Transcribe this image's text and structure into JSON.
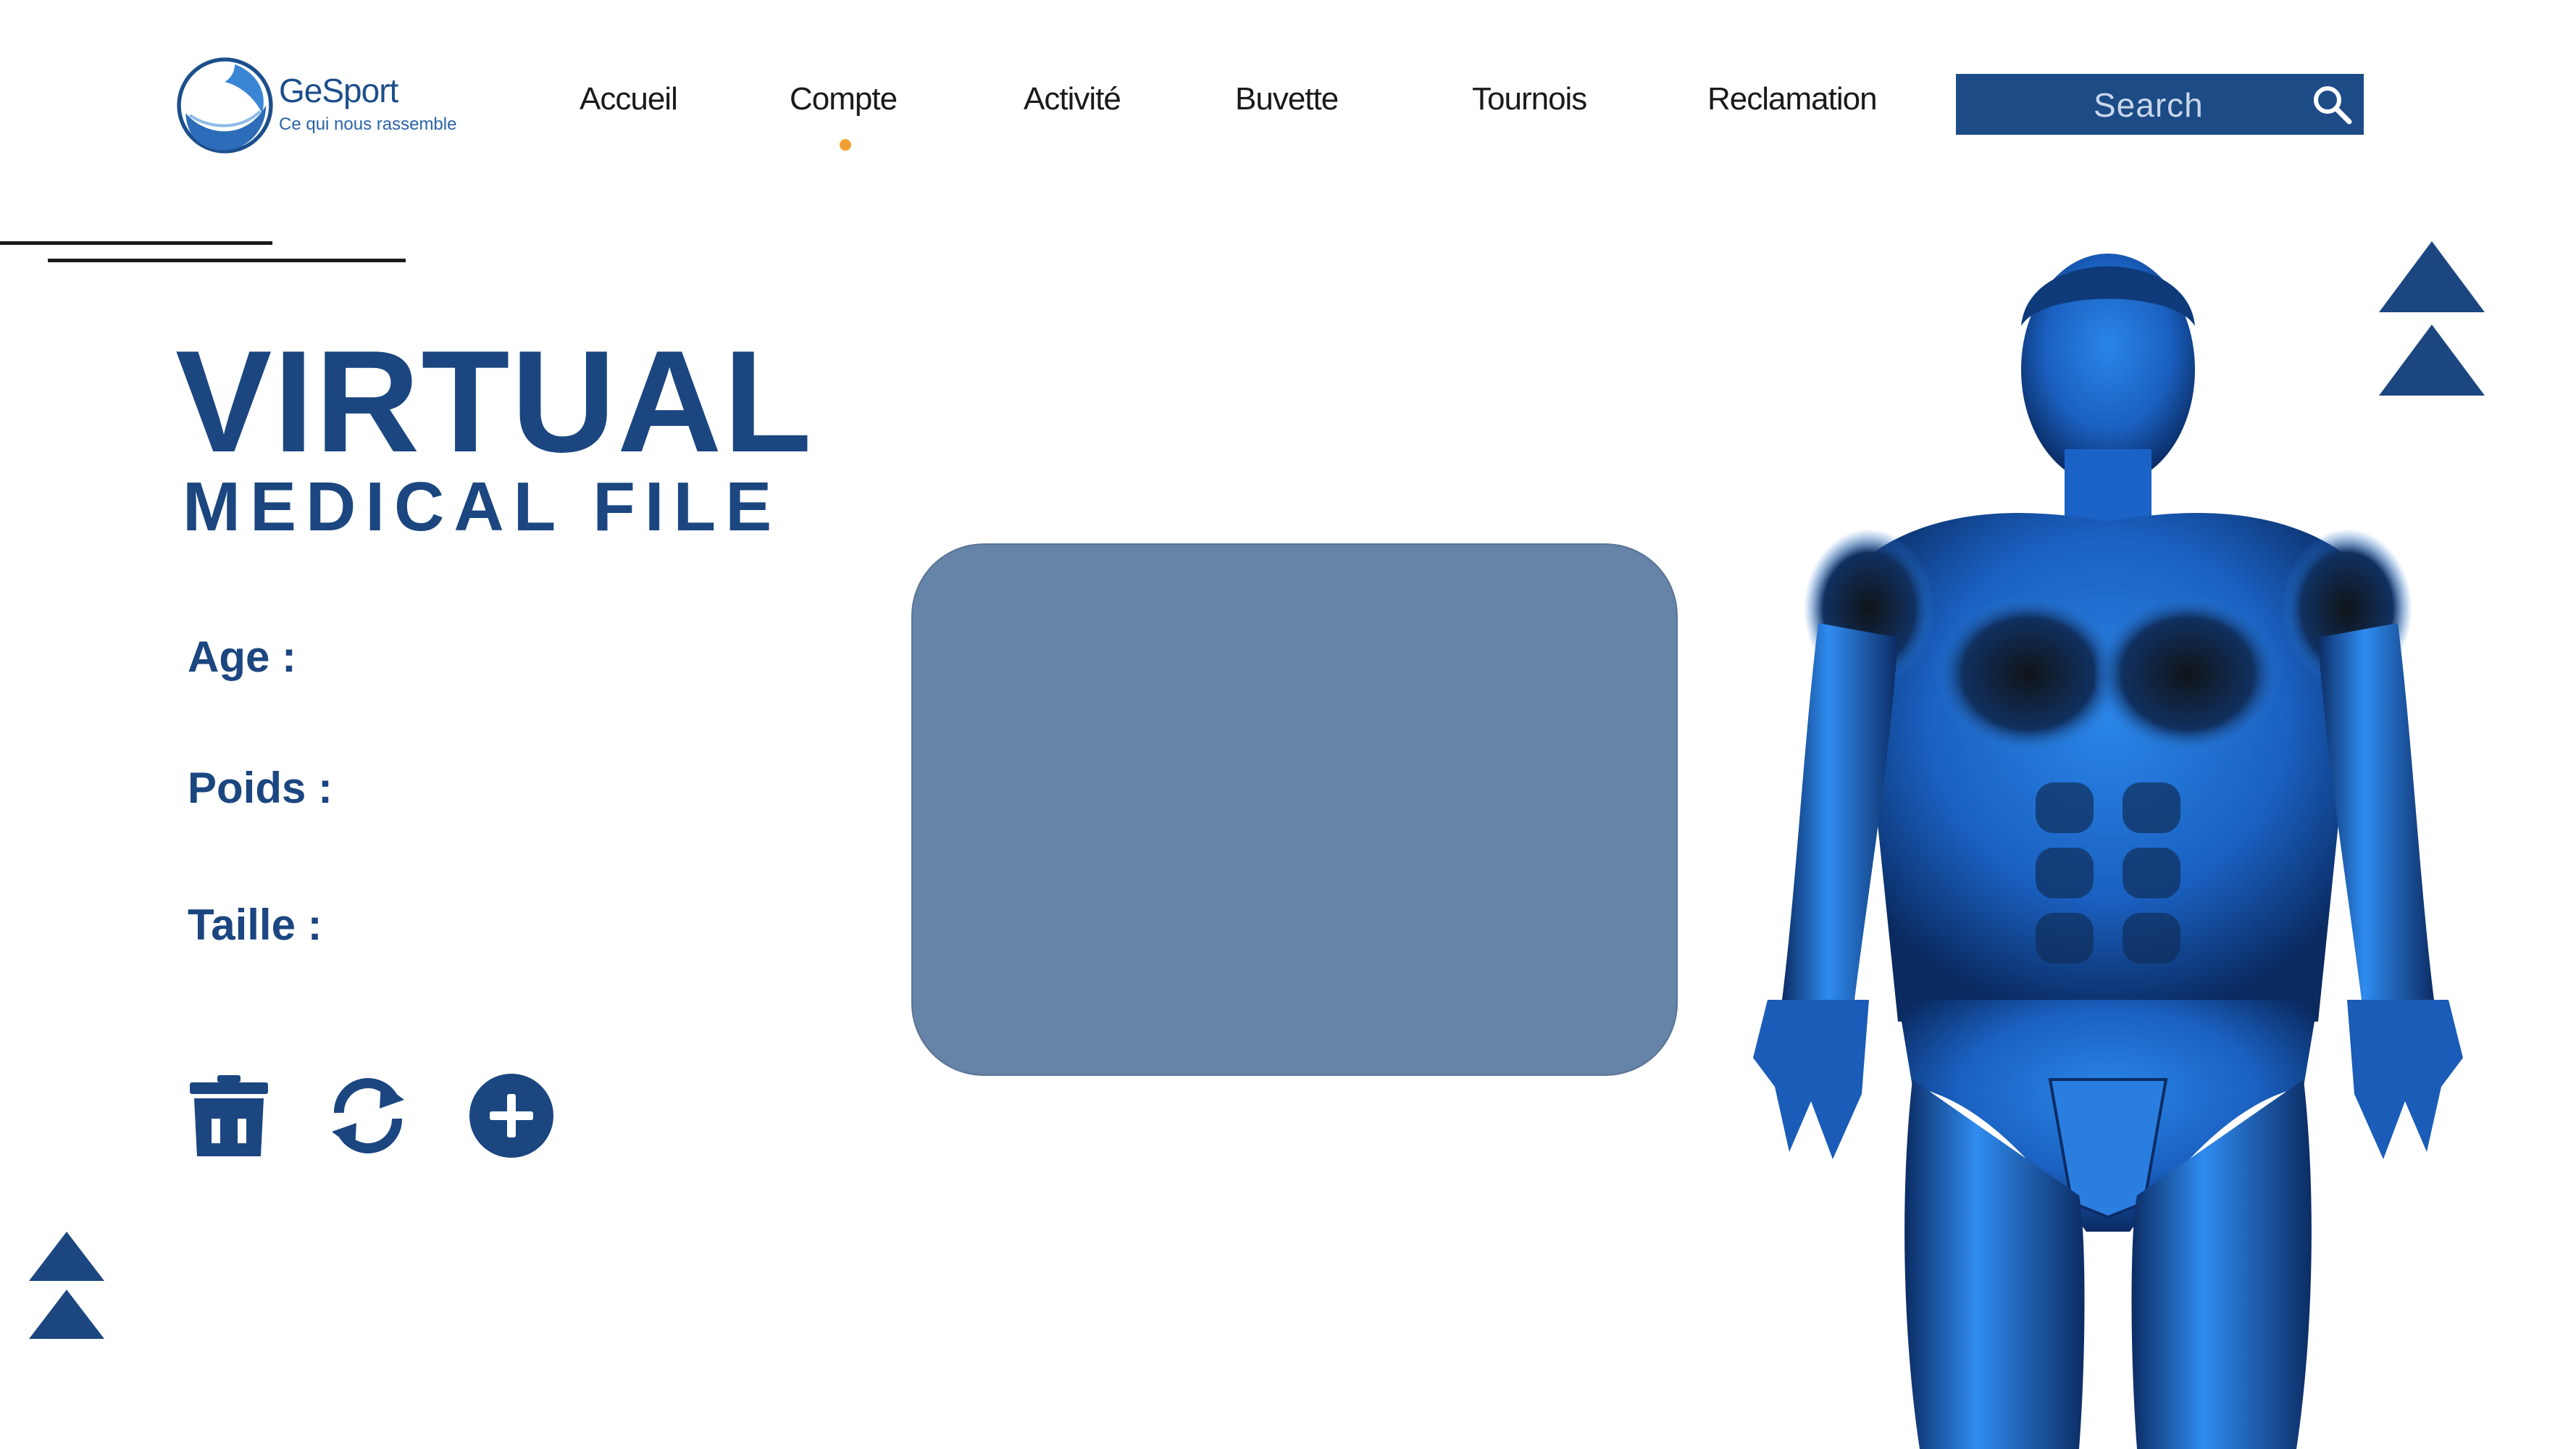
{
  "brand": {
    "name": "GeSport",
    "tagline": "Ce qui nous rassemble"
  },
  "nav": {
    "items": [
      {
        "label": "Accueil"
      },
      {
        "label": "Compte"
      },
      {
        "label": "Activité"
      },
      {
        "label": "Buvette"
      },
      {
        "label": "Tournois"
      },
      {
        "label": "Reclamation"
      }
    ],
    "active": "Compte"
  },
  "search": {
    "placeholder": "Search",
    "icon": "search-icon"
  },
  "hero": {
    "title": "VIRTUAL",
    "subtitle": "MEDICAL FILE"
  },
  "fields": {
    "age_label": "Age :",
    "weight_label": "Poids :",
    "height_label": "Taille :"
  },
  "actions": {
    "delete_icon": "trash-icon",
    "refresh_icon": "refresh-icon",
    "add_icon": "plus-circle-icon"
  },
  "colors": {
    "primary": "#1b4680",
    "search_bg": "#1c4b86",
    "panel": "#6683a8",
    "accent_dot": "#f0a030"
  }
}
